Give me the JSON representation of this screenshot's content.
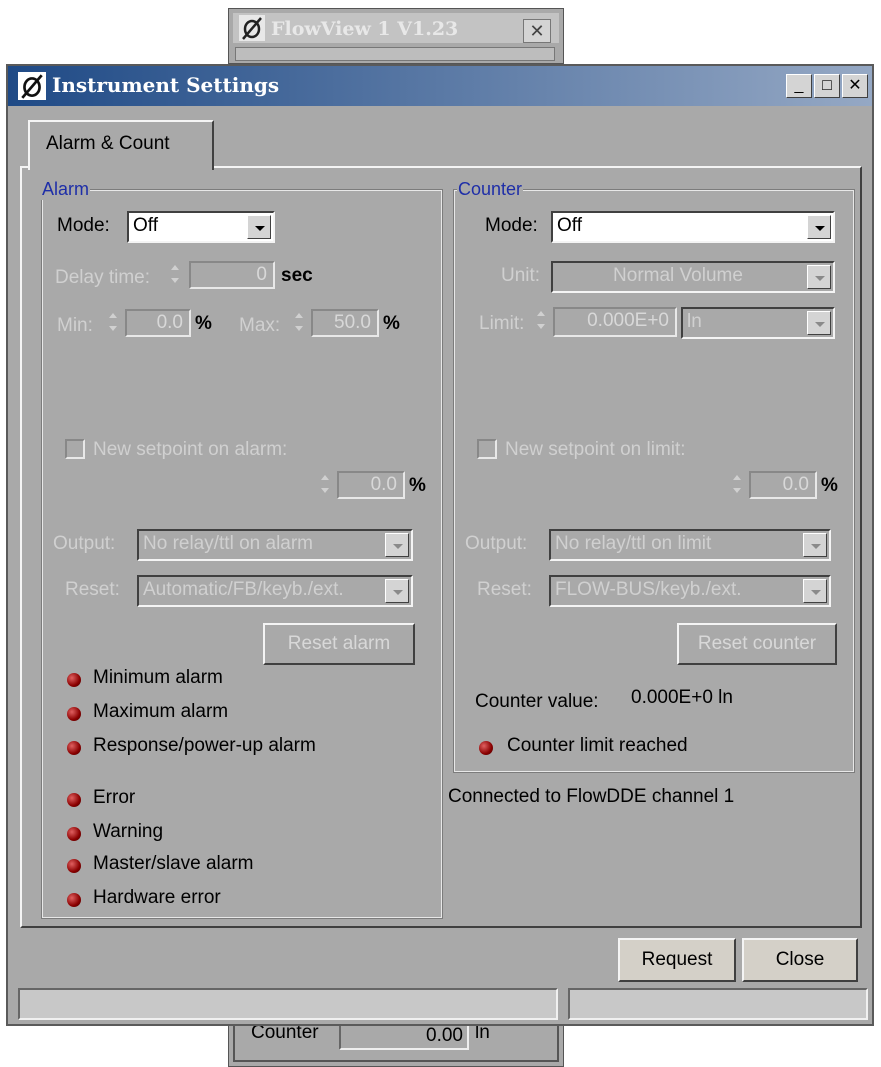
{
  "background_window": {
    "title": "FlowView 1 V1.23",
    "close_glyph": "✕",
    "counter_label": "Counter",
    "counter_value": "0.00",
    "counter_unit": "ln"
  },
  "window": {
    "title": "Instrument Settings",
    "minimize": "_",
    "maximize": "□",
    "close": "✕"
  },
  "tabs": [
    {
      "label": "Alarm & Count",
      "active": true
    }
  ],
  "alarm": {
    "group_label": "Alarm",
    "mode_label": "Mode:",
    "mode_value": "Off",
    "delay_label": "Delay time:",
    "delay_value": "0",
    "delay_unit": "sec",
    "min_label": "Min:",
    "min_value": "0.0",
    "min_unit": "%",
    "max_label": "Max:",
    "max_value": "50.0",
    "max_unit": "%",
    "new_setpoint_label": "New setpoint on alarm:",
    "new_setpoint_value": "0.0",
    "new_setpoint_unit": "%",
    "output_label": "Output:",
    "output_value": "No relay/ttl on alarm",
    "reset_label": "Reset:",
    "reset_value": "Automatic/FB/keyb./ext.",
    "reset_button": "Reset alarm",
    "indicators": [
      "Minimum alarm",
      "Maximum alarm",
      "Response/power-up alarm"
    ],
    "status_indicators": [
      "Error",
      "Warning",
      "Master/slave alarm",
      "Hardware error"
    ]
  },
  "counter": {
    "group_label": "Counter",
    "mode_label": "Mode:",
    "mode_value": "Off",
    "unit_label": "Unit:",
    "unit_value": "Normal Volume",
    "limit_label": "Limit:",
    "limit_value": "0.000E+0",
    "limit_unit_value": "ln",
    "new_setpoint_label": "New setpoint on limit:",
    "new_setpoint_value": "0.0",
    "new_setpoint_unit": "%",
    "output_label": "Output:",
    "output_value": "No relay/ttl on limit",
    "reset_label": "Reset:",
    "reset_value": "FLOW-BUS/keyb./ext.",
    "reset_button": "Reset counter",
    "value_label": "Counter value:",
    "value": "0.000E+0 ln",
    "limit_reached_label": "Counter limit reached"
  },
  "connection_status": "Connected to FlowDDE channel 1",
  "buttons": {
    "request": "Request",
    "close": "Close"
  },
  "colors": {
    "titlebar_start": "#1f4a86",
    "titlebar_end": "#95a8c4",
    "led_red": "#8a0000",
    "legend_blue": "#1e2ea8"
  }
}
